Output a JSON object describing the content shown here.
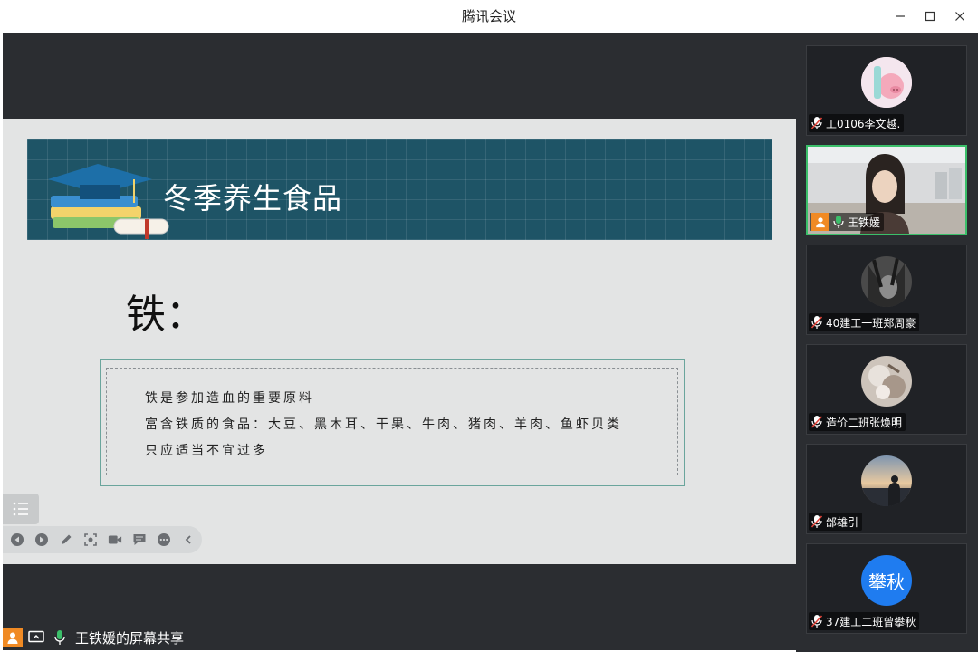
{
  "window": {
    "title": "腾讯会议"
  },
  "slide": {
    "banner_title": "冬季养生食品",
    "heading": "铁：",
    "lines": [
      "铁是参加造血的重要原料",
      "富含铁质的食品：大豆、黑木耳、干果、牛肉、猪肉、羊肉、鱼虾贝类",
      "只应适当不宜过多"
    ]
  },
  "share": {
    "label": "王铁媛的屏幕共享"
  },
  "participants": [
    {
      "name": "工0106李文越.",
      "avatar": "pig-avatar",
      "muted": true
    },
    {
      "name": "王铁媛",
      "avatar": "video-feed",
      "muted": false,
      "host": true
    },
    {
      "name": "40建工一班郑周豪",
      "avatar": "anime-avatar",
      "muted": true
    },
    {
      "name": "造价二班张焕明",
      "avatar": "photo-avatar",
      "muted": true
    },
    {
      "name": "邰雄引",
      "avatar": "sunset-avatar",
      "muted": true
    },
    {
      "name": "37建工二班曾攀秋",
      "avatar_text": "攀秋",
      "muted": true
    }
  ],
  "colors": {
    "stage_bg": "#2b2d31",
    "banner_bg": "#1e5466",
    "active_border": "#3bbf6a",
    "host_badge": "#f08a24",
    "text_avatar": "#1f7cf0"
  }
}
